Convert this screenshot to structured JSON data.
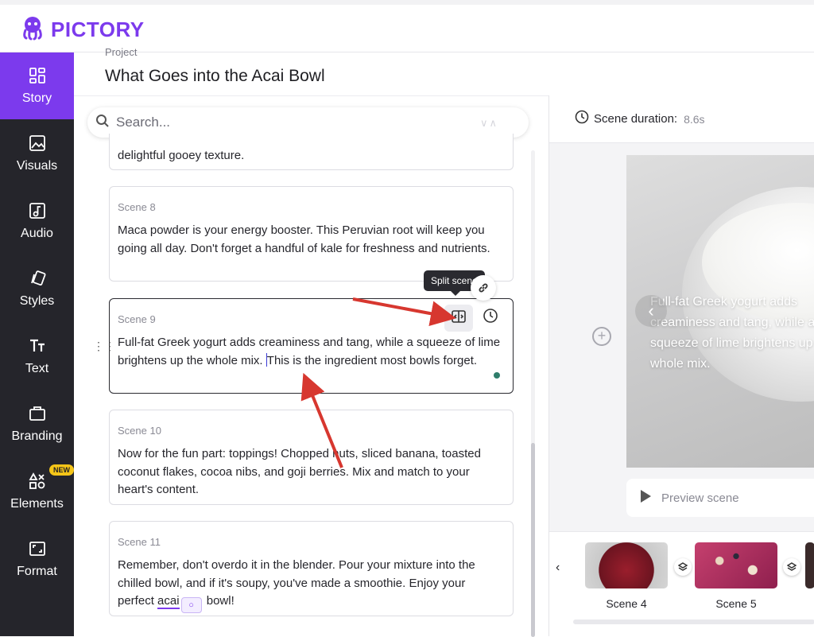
{
  "app": {
    "brand": "PICTORY"
  },
  "sidebar": {
    "items": [
      {
        "label": "Story",
        "icon": "story-icon",
        "active": true
      },
      {
        "label": "Visuals",
        "icon": "visuals-icon"
      },
      {
        "label": "Audio",
        "icon": "audio-icon"
      },
      {
        "label": "Styles",
        "icon": "styles-icon"
      },
      {
        "label": "Text",
        "icon": "text-icon"
      },
      {
        "label": "Branding",
        "icon": "branding-icon"
      },
      {
        "label": "Elements",
        "icon": "elements-icon",
        "badge": "NEW"
      },
      {
        "label": "Format",
        "icon": "format-icon"
      }
    ]
  },
  "project": {
    "label": "Project",
    "title": "What Goes into the Acai Bowl"
  },
  "search": {
    "placeholder": "Search..."
  },
  "scenes": [
    {
      "text": "delightful gooey texture."
    },
    {
      "number": "Scene 8",
      "text": "Maca powder is your energy booster. This Peruvian root will keep you going all day. Don't forget a handful of kale for freshness and nutrients."
    },
    {
      "number": "Scene 9",
      "text_before": "Full-fat Greek yogurt adds creaminess and tang, while a squeeze of lime brightens up the whole mix. ",
      "text_after": "This is the ingredient most bowls forget."
    },
    {
      "number": "Scene 10",
      "text": "Now for the fun part: toppings! Chopped nuts, sliced banana, toasted coconut flakes, cocoa nibs, and goji berries. Mix and match to your heart's content."
    },
    {
      "number": "Scene 11",
      "text_before": "Remember, don't overdo it in the blender. Pour your mixture into the chilled bowl, and if it's soupy, you've made a smoothie. Enjoy your perfect ",
      "keyword": "acai",
      "text_after": " bowl!"
    }
  ],
  "tooltip": {
    "split_scene": "Split scene"
  },
  "preview": {
    "duration_label": "Scene duration:",
    "duration_value": "8.6s",
    "caption": "Full-fat Greek yogurt adds creaminess and tang, while a squeeze of lime brightens up the whole mix.",
    "preview_label": "Preview scene"
  },
  "filmstrip": {
    "thumbs": [
      {
        "label": "Scene 4"
      },
      {
        "label": "Scene 5"
      }
    ]
  },
  "colors": {
    "accent": "#7c3aed",
    "sidebar_bg": "#25252b",
    "annotation": "#d7372f"
  }
}
